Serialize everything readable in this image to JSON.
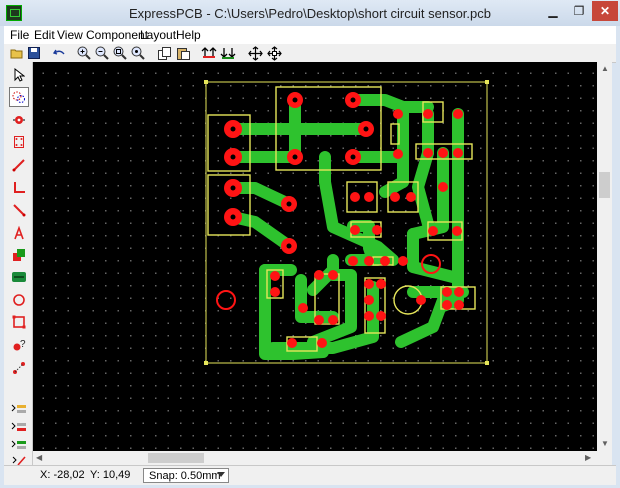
{
  "window": {
    "title": "ExpressPCB - C:\\Users\\Pedro\\Desktop\\short circuit sensor.pcb",
    "minimize": "▁",
    "maximize": "❐",
    "close": "✕"
  },
  "menu": [
    "File",
    "Edit",
    "View",
    "Component",
    "Layout",
    "Help"
  ],
  "toolbar": [
    "open-icon",
    "save-icon",
    "undo-icon",
    "zoom-in-icon",
    "zoom-out-icon",
    "zoom-box-icon",
    "zoom-fit-icon",
    "copy-icon",
    "paste-icon",
    "pad-up-icon",
    "pad-down-icon",
    "move-icon",
    "center-icon"
  ],
  "tools": [
    "pointer-icon",
    "lasso-icon",
    "pad-tool-icon",
    "component-tool-icon",
    "trace-tool-icon",
    "corner-tool-icon",
    "diagonal-tool-icon",
    "text-tool-icon",
    "fill-tool-icon",
    "plane-tool-icon",
    "circle-tool-icon",
    "rectangle-tool-icon",
    "inspect-tool-icon",
    "ratsnest-tool-icon",
    "layer-top-icon",
    "layer-bottom-icon",
    "layer-silk-icon",
    "layer-all-icon"
  ],
  "status": {
    "x": "X: -28,02",
    "y": "Y: 10,49",
    "snap": "Snap:  0.50mm"
  },
  "colors": {
    "trace": "#2ec22e",
    "pad": "#ff1414",
    "silkscreen": "#e6e65a",
    "board_background": "#000000"
  }
}
